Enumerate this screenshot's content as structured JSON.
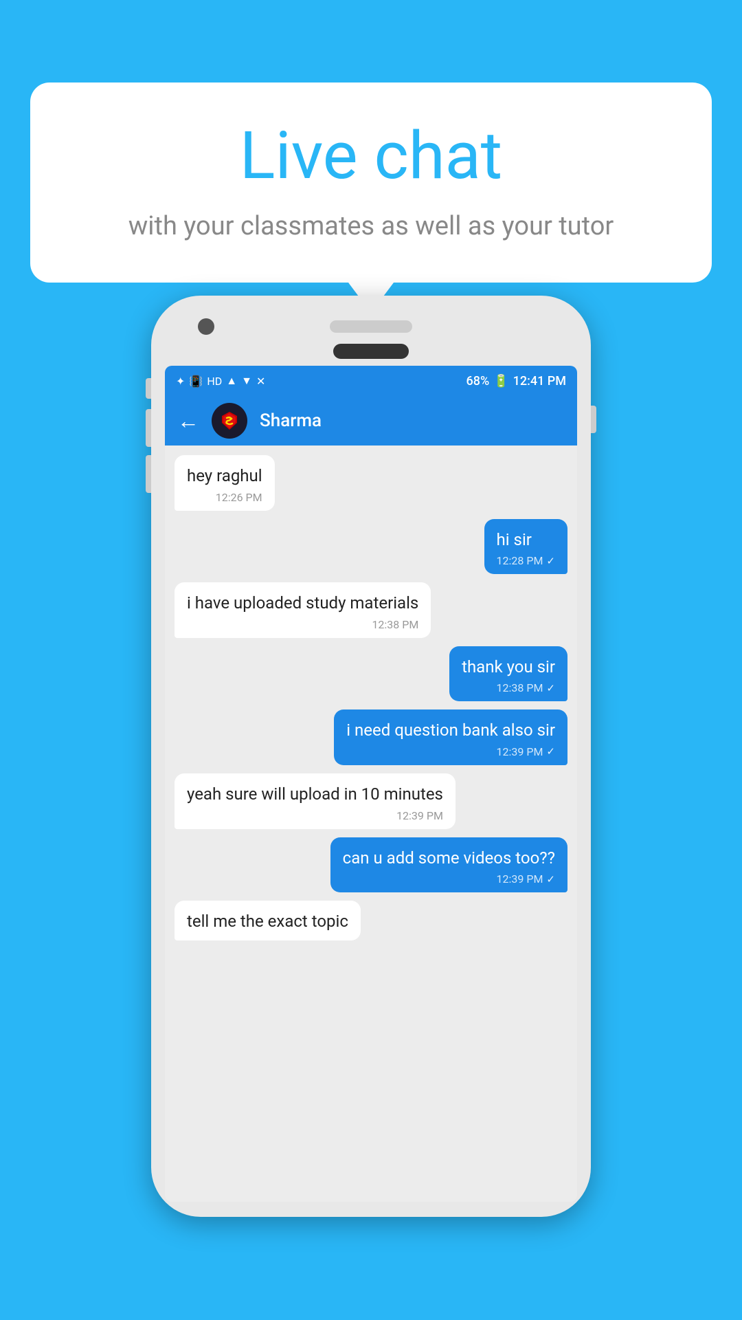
{
  "background_color": "#29b6f6",
  "speech_bubble": {
    "title": "Live chat",
    "subtitle": "with your classmates as well as your tutor"
  },
  "phone": {
    "status_bar": {
      "time": "12:41 PM",
      "battery": "68%",
      "icons": [
        "bluetooth",
        "vibrate",
        "hd",
        "wifi",
        "signal1",
        "signal2"
      ]
    },
    "app_bar": {
      "contact_name": "Sharma",
      "back_label": "←"
    },
    "messages": [
      {
        "id": 1,
        "type": "received",
        "text": "hey raghul",
        "time": "12:26 PM",
        "check": null
      },
      {
        "id": 2,
        "type": "sent",
        "text": "hi sir",
        "time": "12:28 PM",
        "check": "✓"
      },
      {
        "id": 3,
        "type": "received",
        "text": "i have uploaded study materials",
        "time": "12:38 PM",
        "check": null
      },
      {
        "id": 4,
        "type": "sent",
        "text": "thank you sir",
        "time": "12:38 PM",
        "check": "✓"
      },
      {
        "id": 5,
        "type": "sent",
        "text": "i need question bank also sir",
        "time": "12:39 PM",
        "check": "✓"
      },
      {
        "id": 6,
        "type": "received",
        "text": "yeah sure will upload in 10 minutes",
        "time": "12:39 PM",
        "check": null
      },
      {
        "id": 7,
        "type": "sent",
        "text": "can u add some videos too??",
        "time": "12:39 PM",
        "check": "✓"
      },
      {
        "id": 8,
        "type": "received",
        "text": "tell me the exact topic",
        "time": "",
        "check": null,
        "partial": true
      }
    ]
  }
}
